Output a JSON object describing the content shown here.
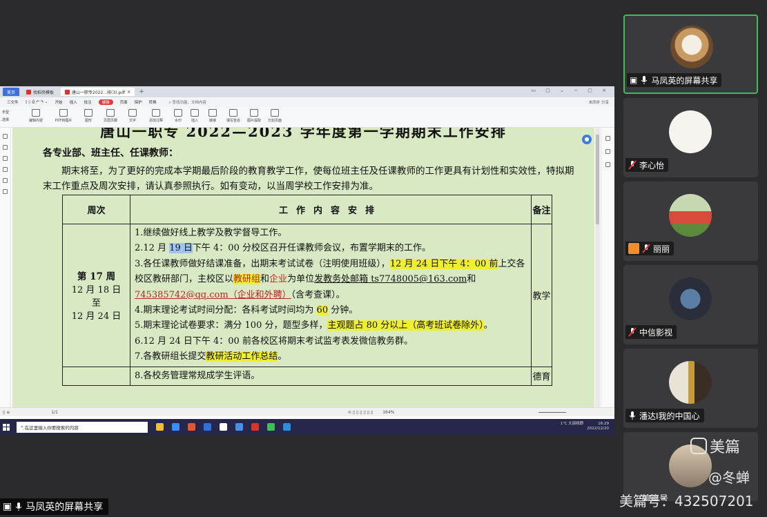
{
  "app": {
    "tabs": [
      {
        "label": "首页"
      },
      {
        "label": "找稻壳模板"
      },
      {
        "label": "唐山一职专2022...排(3).pdf"
      }
    ],
    "menu": [
      "三文件",
      "开始",
      "插入",
      "批注",
      "编辑",
      "页面",
      "保护",
      "转换"
    ],
    "menu_highlight": "编辑",
    "menu_search": "查找功能、文档内容",
    "menu_right": "未同步  分享",
    "toolbar_left": [
      "手型",
      "选择"
    ],
    "toolbar": [
      "编辑内容",
      "PDF转图片",
      "图形",
      "页眉页脚",
      "文字",
      "添加注释",
      "水印",
      "插入",
      "链接",
      "填写签名",
      "图片提取",
      "分割页面"
    ],
    "page_indicator": "1/1",
    "zoom": "164%",
    "taskbar_search": "在这里输入你要搜索的内容",
    "tray_line1": "1℃ 大部晴朗",
    "tray_time": "16:29",
    "tray_date": "2022/12/20"
  },
  "document": {
    "title": "唐山一职专 2022—2023 学年度第一学期期末工作安排",
    "salutation": "各专业部、班主任、任课教师：",
    "intro": "期末将至，为了更好的完成本学期最后阶段的教育教学工作，使每位班主任及任课教师的工作更具有计划性和实效性，特拟期末工作重点及周次安排，请认真参照执行。如有变动，以当周学校工作安排为准。",
    "table": {
      "header": [
        "周次",
        "工作内容安排",
        "备注"
      ],
      "week_label": "第 17 周",
      "week_range": [
        "12 月 18 日",
        "至",
        "12 月 24 日"
      ],
      "remark": "教学",
      "items": {
        "i1": "1.继续做好线上教学及教学督导工作。",
        "i2a": "2.12 月 ",
        "i2b": "19 日",
        "i2c": "下午 4：00 分校区召开任课教师会议，布置学期末的工作。",
        "i3a": "3.各任课教师做好结课准备，出期末考试试卷（注明使用班级），",
        "i3b": "12 月 24 日下午 4：00 前",
        "i3c": "上交各校区教研部门，主校区以",
        "i3d": "教研组",
        "i3e": "和",
        "i3f": "企业",
        "i3g": "为单位",
        "i3h": "发教务处邮箱 ts7748005@163.com",
        "i3i": "和",
        "i3j": "745385742@qq.com（企业和外聘）",
        "i3k": "（含考查课）。",
        "i4a": "4.期末理论考试时间分配：各科考试时间均为 ",
        "i4b": "60",
        "i4c": " 分钟。",
        "i5a": "5.期末理论试卷要求：满分 100 分，题型多样，",
        "i5b": "主观题占 80 分以上（高考班试卷除外）",
        "i5c": "。",
        "i6": "6.12 月 24 日下午 4：00 前各校区将期末考试监考表发微信教务群。",
        "i7a": "7.各教研组长提交",
        "i7b": "教研活动工作总结",
        "i7c": "。",
        "i8": "8.各校务管理常规成学生评语。",
        "row2_remark": "德育"
      }
    }
  },
  "participants": [
    {
      "name": "马凤英的屏幕共享",
      "active": true
    },
    {
      "name": "李心怡"
    },
    {
      "name": "丽丽"
    },
    {
      "name": "中信影视"
    },
    {
      "name": "潘达I我的中国心"
    },
    {
      "name": "美篇号"
    }
  ],
  "bottom_share_label": "马凤英的屏幕共享",
  "watermark": {
    "brand": "美篇",
    "author": "@冬蝉",
    "id": "美篇号：432507201"
  }
}
